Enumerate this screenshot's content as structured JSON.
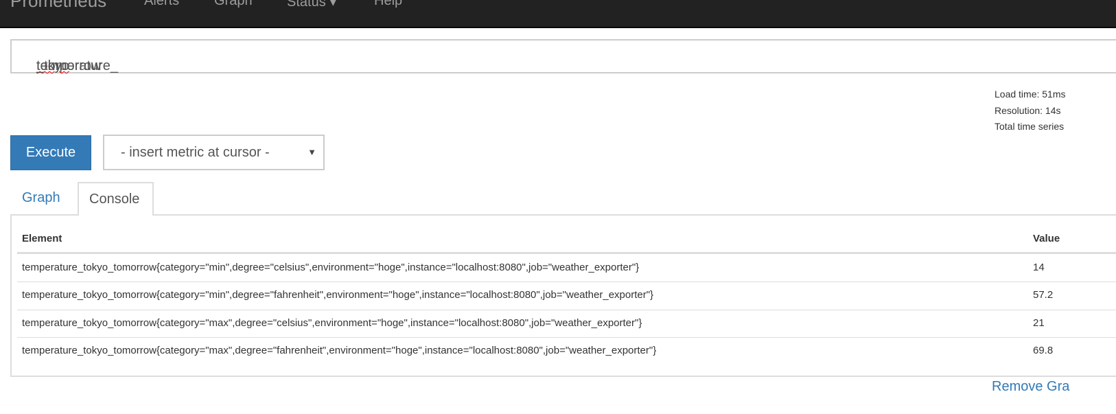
{
  "navbar": {
    "brand": "Prometheus",
    "items": [
      {
        "label": "Alerts"
      },
      {
        "label": "Graph"
      },
      {
        "label": "Status ▾"
      },
      {
        "label": "Help"
      }
    ]
  },
  "query": {
    "prefix": "temperature_",
    "misspelled": "tokyo",
    "suffix": "_tomorrow"
  },
  "stats": {
    "load_time": "Load time: 51ms",
    "resolution": "Resolution: 14s",
    "total_series": "Total time series"
  },
  "controls": {
    "execute_label": "Execute",
    "metric_select": "- insert metric at cursor -",
    "select_icon": "triangle-down"
  },
  "tabs": [
    {
      "label": "Graph",
      "active": false
    },
    {
      "label": "Console",
      "active": true
    }
  ],
  "table": {
    "headers": [
      "Element",
      "Value"
    ],
    "rows": [
      {
        "element": "temperature_tokyo_tomorrow{category=\"min\",degree=\"celsius\",environment=\"hoge\",instance=\"localhost:8080\",job=\"weather_exporter\"}",
        "value": "14"
      },
      {
        "element": "temperature_tokyo_tomorrow{category=\"min\",degree=\"fahrenheit\",environment=\"hoge\",instance=\"localhost:8080\",job=\"weather_exporter\"}",
        "value": "57.2"
      },
      {
        "element": "temperature_tokyo_tomorrow{category=\"max\",degree=\"celsius\",environment=\"hoge\",instance=\"localhost:8080\",job=\"weather_exporter\"}",
        "value": "21"
      },
      {
        "element": "temperature_tokyo_tomorrow{category=\"max\",degree=\"fahrenheit\",environment=\"hoge\",instance=\"localhost:8080\",job=\"weather_exporter\"}",
        "value": "69.8"
      }
    ]
  },
  "remove_graph": "Remove Gra",
  "colors": {
    "primary": "#337ab7",
    "navbar": "#222222"
  }
}
